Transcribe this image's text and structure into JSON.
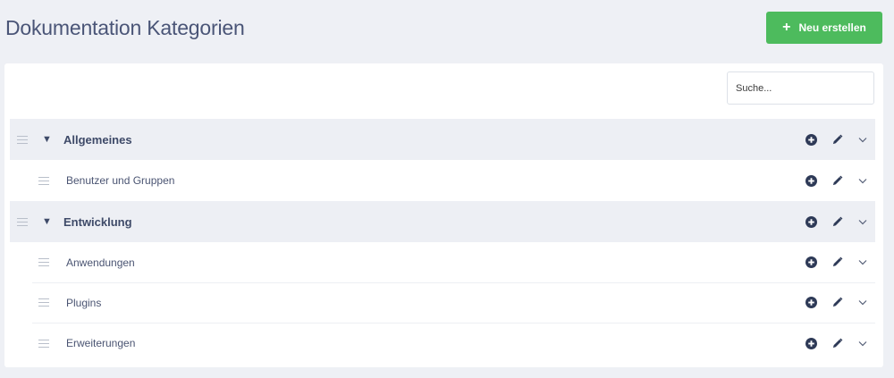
{
  "page": {
    "title": "Dokumentation Kategorien",
    "new_button_label": "Neu erstellen",
    "search_placeholder": "Suche..."
  },
  "colors": {
    "accent_green": "#4dbb5d",
    "parent_row_bg": "#edeff4",
    "page_bg": "#eef0f5",
    "text": "#3e4a68"
  },
  "icons": {
    "add": "plus-circle-icon",
    "edit": "pencil-icon",
    "expand": "chevron-down-icon",
    "drag": "drag-handle-icon",
    "collapse": "triangle-down-icon"
  },
  "categories": [
    {
      "label": "Allgemeines",
      "children": [
        {
          "label": "Benutzer und Gruppen"
        }
      ]
    },
    {
      "label": "Entwicklung",
      "children": [
        {
          "label": "Anwendungen"
        },
        {
          "label": "Plugins"
        },
        {
          "label": "Erweiterungen"
        }
      ]
    }
  ]
}
